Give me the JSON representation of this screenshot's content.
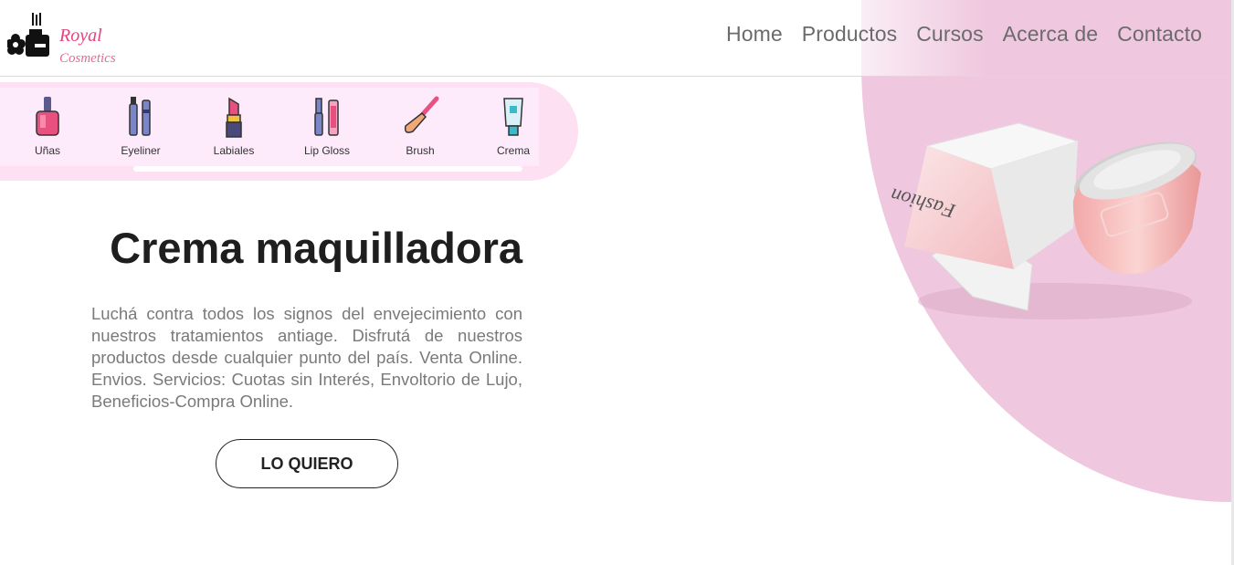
{
  "brand": {
    "line1": "Royal",
    "line2": "Cosmetics",
    "logo_icon": "perfume-flower-logo-icon"
  },
  "nav": {
    "items": [
      "Home",
      "Productos",
      "Cursos",
      "Acerca de",
      "Contacto"
    ]
  },
  "categories": [
    {
      "label": "Uñas",
      "icon": "nail-polish-icon"
    },
    {
      "label": "Eyeliner",
      "icon": "eyeliner-icon"
    },
    {
      "label": "Labiales",
      "icon": "lipstick-icon"
    },
    {
      "label": "Lip Gloss",
      "icon": "lip-gloss-icon"
    },
    {
      "label": "Brush",
      "icon": "brush-icon"
    },
    {
      "label": "Crema",
      "icon": "cream-tube-icon"
    }
  ],
  "hero": {
    "title": "Crema maquilladora",
    "description": "Luchá contra todos los signos del envejecimiento con nuestros tratamientos antiage. Disfrutá de nuestros productos desde cualquier punto del país. Venta Online. Envios. Servicios: Cuotas sin Interés, Envoltorio de Lujo, Beneficios-Compra Online.",
    "cta_label": "LO QUIERO",
    "product_box_text": "Fashion"
  },
  "colors": {
    "accent_pink": "#efc8df",
    "strip_pink": "#fde0f2",
    "logo_pink": "#e5447f"
  }
}
